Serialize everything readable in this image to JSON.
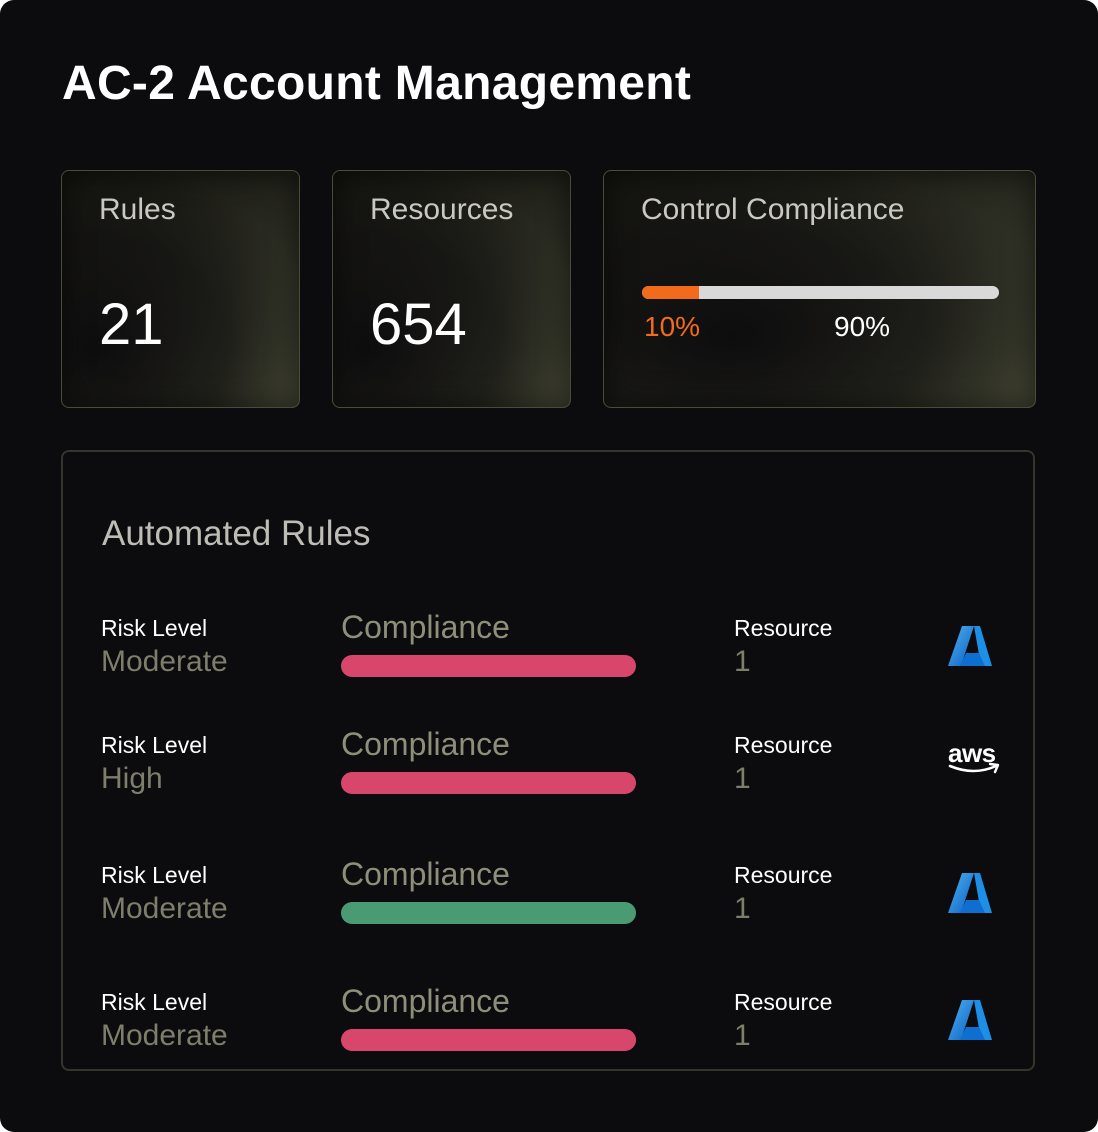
{
  "title": "AC-2 Account Management",
  "summary": {
    "rules": {
      "label": "Rules",
      "value": "21"
    },
    "resources": {
      "label": "Resources",
      "value": "654"
    },
    "control_compliance": {
      "label": "Control Compliance",
      "fail_percent_text": "10%",
      "pass_percent_text": "90%",
      "fail_color": "#f26b1d",
      "pass_color": "#d9d9d9"
    }
  },
  "automated_rules": {
    "title": "Automated Rules",
    "rows": [
      {
        "risk_label": "Risk Level",
        "risk_value": "Moderate",
        "compliance_label": "Compliance",
        "compliance_color": "#d8476b",
        "resource_label": "Resource",
        "resource_value": "1",
        "provider_icon": "azure-icon"
      },
      {
        "risk_label": "Risk Level",
        "risk_value": "High",
        "compliance_label": "Compliance",
        "compliance_color": "#d8476b",
        "resource_label": "Resource",
        "resource_value": "1",
        "provider_icon": "aws-icon",
        "provider_text": "aws"
      },
      {
        "risk_label": "Risk Level",
        "risk_value": "Moderate",
        "compliance_label": "Compliance",
        "compliance_color": "#4a9b74",
        "resource_label": "Resource",
        "resource_value": "1",
        "provider_icon": "azure-icon"
      },
      {
        "risk_label": "Risk Level",
        "risk_value": "Moderate",
        "compliance_label": "Compliance",
        "compliance_color": "#d8476b",
        "resource_label": "Resource",
        "resource_value": "1",
        "provider_icon": "azure-icon"
      }
    ]
  }
}
